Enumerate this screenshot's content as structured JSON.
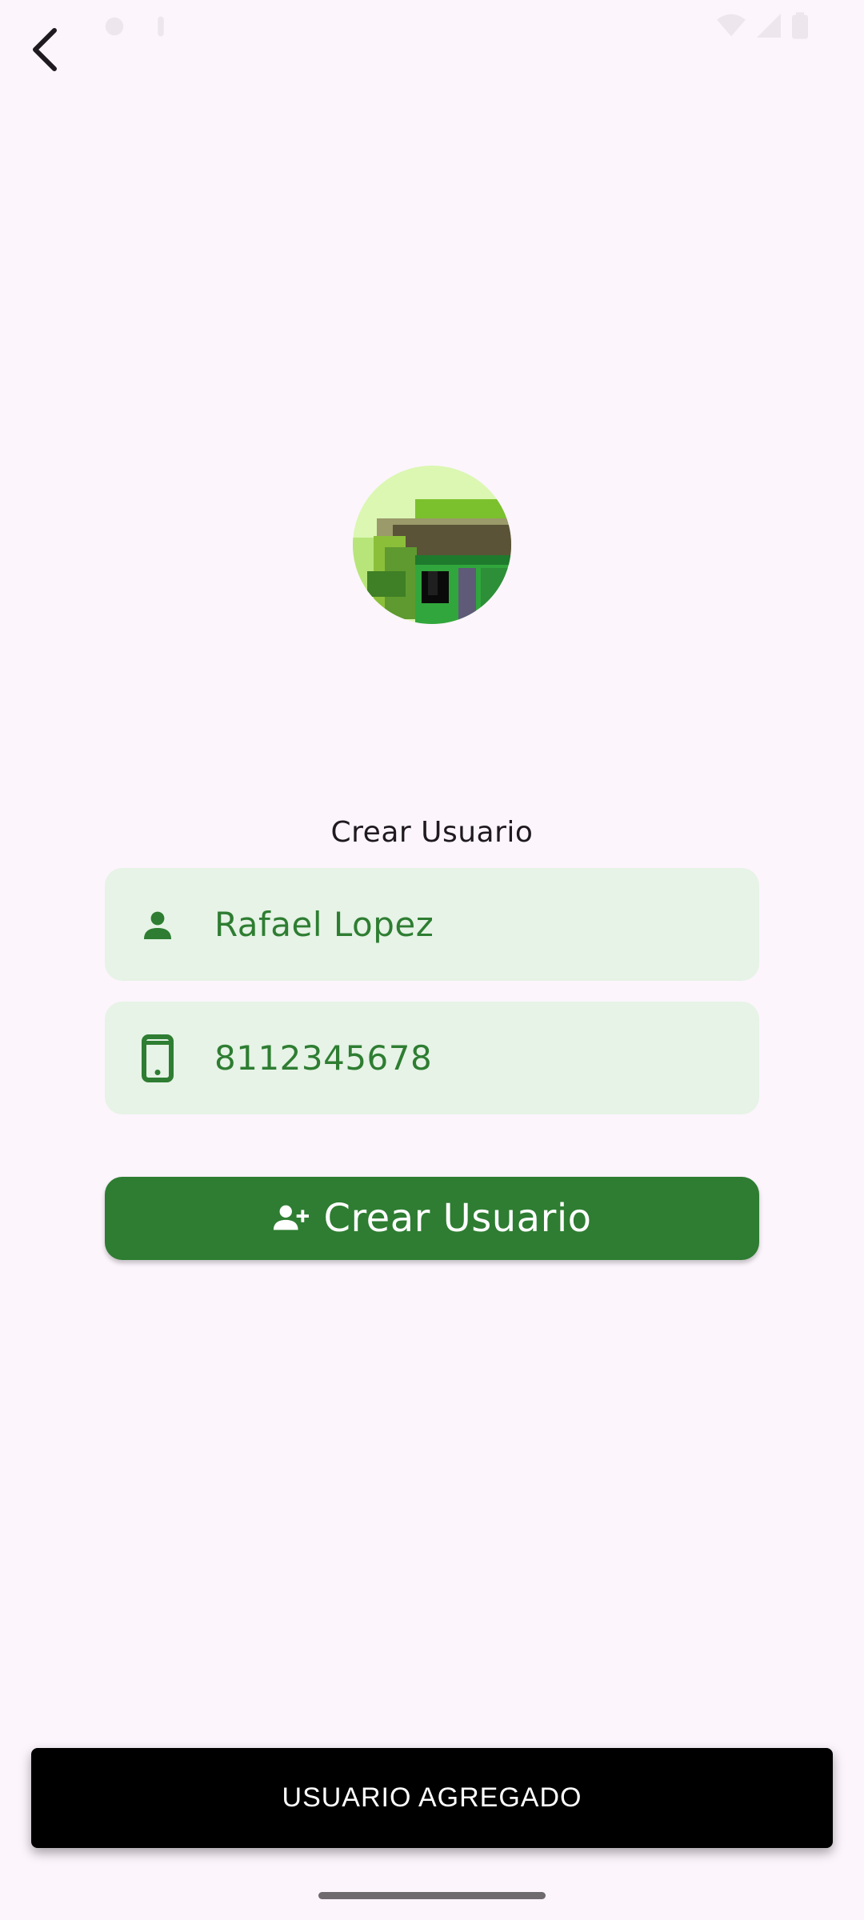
{
  "colors": {
    "background": "#fcf5fc",
    "primary": "#2e7d32",
    "field_bg": "#e6f3e6",
    "snackbar_bg": "#000000"
  },
  "nav": {
    "back_icon": "back-arrow-icon"
  },
  "avatar": {
    "icon": "avatar-image"
  },
  "form": {
    "title": "Crear Usuario",
    "name_field": {
      "icon": "person-icon",
      "value": "Rafael Lopez"
    },
    "phone_field": {
      "icon": "phone-icon",
      "value": "8112345678"
    },
    "submit": {
      "icon": "add-person-icon",
      "label": "Crear Usuario"
    }
  },
  "snackbar": {
    "message": "USUARIO AGREGADO"
  }
}
